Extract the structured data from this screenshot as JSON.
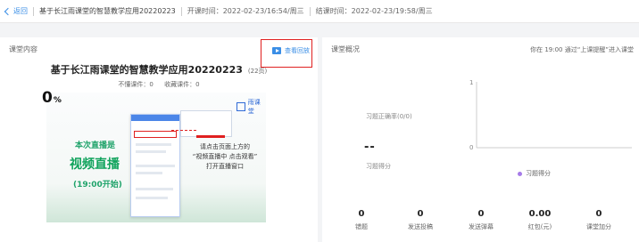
{
  "topbar": {
    "back_label": "返回",
    "course_title": "基于长江雨课堂的智慧教学应用20220223",
    "start_time": "开课时间：2022-02-23/16:54/周三",
    "end_time": "结课时间：2022-02-23/19:58/周三"
  },
  "left_panel": {
    "title": "课堂内容",
    "replay_label": "查看回放",
    "course_name": "基于长江雨课堂的智慧教学应用20220223",
    "pages": "(22页)",
    "unread": "不懂课件：0",
    "favorite": "收藏课件：0",
    "poster": {
      "logo": "雨课堂",
      "line1": "本次直播是",
      "line2": "视频直播",
      "line3": "(19:00开始)",
      "right_lines": [
        "请点击页面上方的",
        "“视频直播中 点击观看”",
        "打开直播窗口"
      ]
    }
  },
  "right_panel": {
    "title": "课堂概况",
    "hint": "你在 19:00 通过“上课提醒”进入课堂",
    "accuracy_value": "0",
    "accuracy_unit": "%",
    "accuracy_label": "习题正确率(0/0)",
    "score_value": "--",
    "score_label": "习题得分",
    "chart": {
      "y_max": "1",
      "y_min": "0",
      "legend": "习题得分",
      "legend_color": "#a67be8"
    }
  },
  "stats": [
    {
      "value": "0",
      "label": "错题"
    },
    {
      "value": "0",
      "label": "发送投稿"
    },
    {
      "value": "0",
      "label": "发送弹幕"
    },
    {
      "value": "0.00",
      "label": "红包(元)"
    },
    {
      "value": "0",
      "label": "课堂加分"
    }
  ]
}
